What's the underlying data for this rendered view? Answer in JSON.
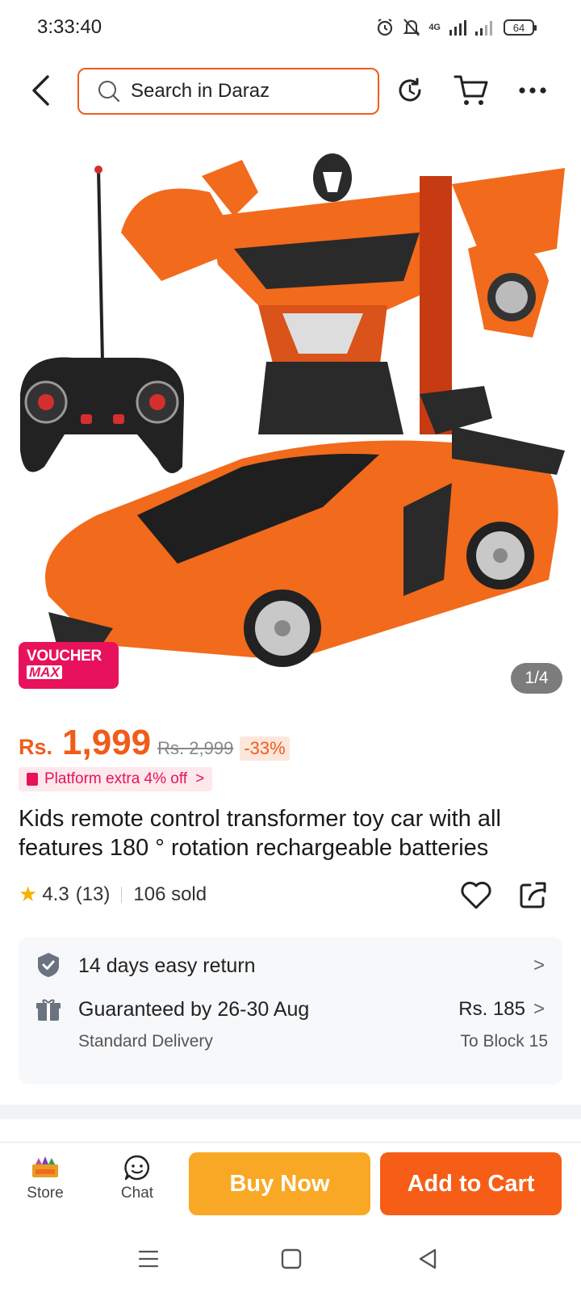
{
  "status_bar": {
    "time": "3:33:40",
    "network_label": "4G",
    "battery": "64"
  },
  "search": {
    "placeholder": "Search in Daraz"
  },
  "gallery": {
    "counter": "1/4",
    "voucher_line1": "VOUCHER",
    "voucher_line2": "MAX",
    "product_colors": {
      "car": "#f26a1b",
      "robot_dark": "#2a2a2a",
      "remote": "#222222"
    }
  },
  "price": {
    "currency": "Rs.",
    "amount": "1,999",
    "original": "Rs. 2,999",
    "discount": "-33%"
  },
  "promo": {
    "text": "Platform extra 4% off",
    "chevron": ">"
  },
  "product": {
    "title": "Kids remote control transformer toy car with all features 180 ° rotation rechargeable batteries",
    "rating": "4.3",
    "rating_count": "(13)",
    "sold": "106 sold"
  },
  "info": {
    "return_text": "14 days easy return",
    "delivery_text": "Guaranteed by 26-30 Aug",
    "delivery_type": "Standard Delivery",
    "delivery_price": "Rs. 185",
    "delivery_location": "To Block 15",
    "chevron": ">"
  },
  "bottom_bar": {
    "store_label": "Store",
    "chat_label": "Chat",
    "buy_now": "Buy Now",
    "add_to_cart": "Add to Cart"
  },
  "colors": {
    "brand_orange": "#f05c1a",
    "buy_now": "#f9a825",
    "add_to_cart": "#f65e17",
    "voucher": "#e8125c",
    "star": "#f6b300"
  },
  "icons": {
    "back": "chevron-left-icon",
    "search": "search-icon",
    "reload": "reload-icon",
    "cart": "cart-icon",
    "more": "more-icon",
    "favorite": "heart-icon",
    "share": "share-icon",
    "return": "shield-check-icon",
    "delivery": "gift-box-icon"
  }
}
